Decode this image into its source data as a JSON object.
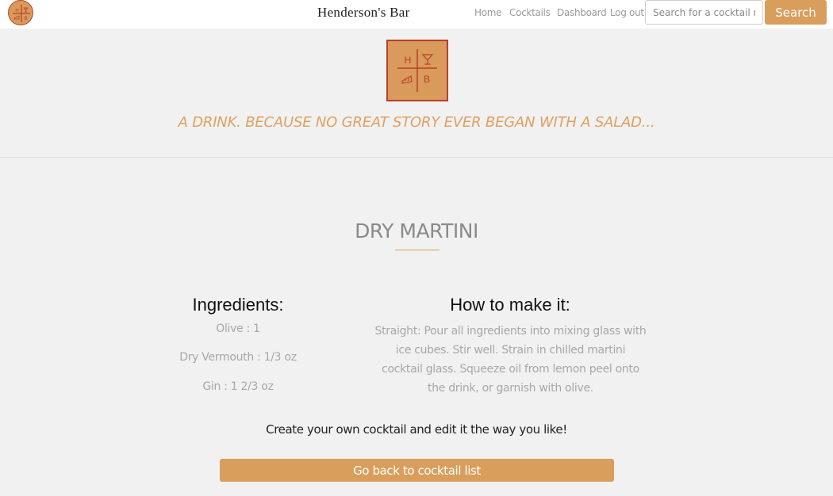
{
  "navbar": {
    "brand": "Henderson's Bar",
    "links": [
      "Home",
      "Cocktails",
      "Dashboard",
      "Log out"
    ],
    "search_placeholder": "Search for a cocktail name",
    "search_label": "Search"
  },
  "logo": {
    "letters": [
      "H",
      "B"
    ],
    "colors": {
      "fill": "#d99a5b",
      "stroke": "#b6412b"
    }
  },
  "hero": {
    "tagline": "A DRINK. BECAUSE NO GREAT STORY EVER BEGAN WITH A SALAD..."
  },
  "cocktail": {
    "name": "DRY MARTINI",
    "ingredients_heading": "Ingredients:",
    "ingredients": [
      "Olive : 1",
      "Dry Vermouth : 1/3 oz",
      "Gin : 1 2/3 oz"
    ],
    "method_heading": "How to make it:",
    "method": "Straight: Pour all ingredients into mixing glass with ice cubes. Stir well. Strain in chilled martini cocktail glass. Squeeze oil from lemon peel onto the drink, or garnish with olive."
  },
  "footer": {
    "create_text": "Create your own cocktail and edit it the way you like!",
    "back_button": "Go back to cocktail list"
  },
  "colors": {
    "accent": "#d99e5c",
    "tagline": "#e0a060",
    "muted_text": "#a7a7a7",
    "background": "#f1f1f1"
  }
}
